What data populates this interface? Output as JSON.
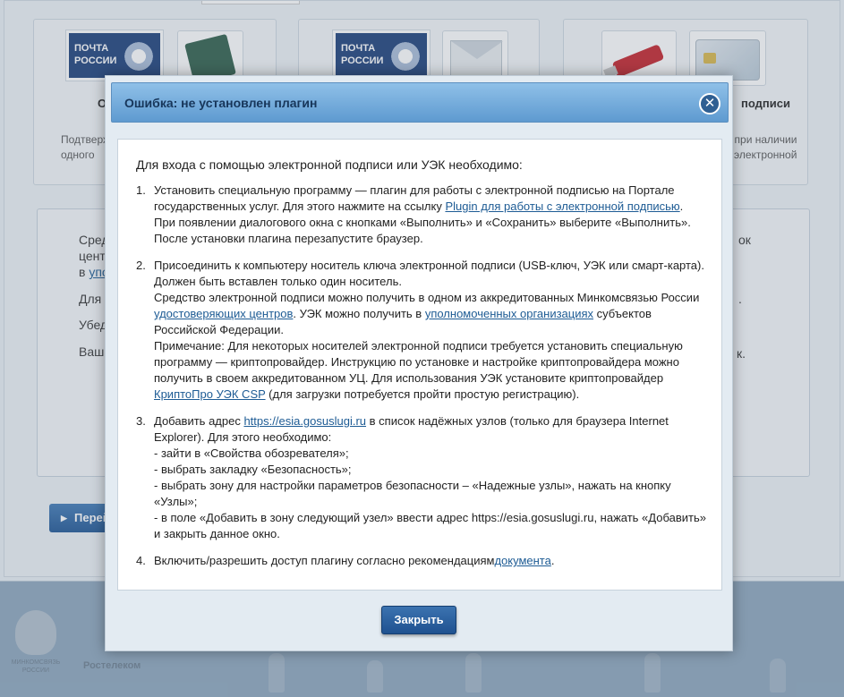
{
  "background": {
    "cards": [
      {
        "logo": "ПОЧТА РОССИИ",
        "logo_line1": "ПОЧТА",
        "logo_line2": "РОССИИ",
        "title_fragment": "О",
        "desc_fragment": "Подтверж\nодного"
      },
      {
        "logo": "ПОЧТА РОССИИ",
        "logo_line1": "ПОЧТА",
        "logo_line2": "РОССИИ",
        "title_fragment": "",
        "desc_fragment": ""
      },
      {
        "title_fragment": "подписи",
        "desc_fragment": "при наличии\nэлектронной"
      }
    ],
    "panel_left_texts": [
      "Сред",
      "цент",
      "в ",
      "упо",
      "Для",
      "Убед",
      "Ваш"
    ],
    "panel_right_texts": [
      "ок",
      ".",
      "к."
    ],
    "button_label": "Перей",
    "footer": {
      "minkom": "МИНКОМСВЯЗЬ РОССИИ",
      "rostelecom": "Ростелеком"
    }
  },
  "modal": {
    "title": "Ошибка: не установлен плагин",
    "intro": "Для входа с помощью электронной подписи или УЭК необходимо:",
    "steps": [
      {
        "num": "1.",
        "text_before_link": "Установить специальную программу — плагин для работы с электронной подписью на Портале государственных услуг. Для этого нажмите на ссылку ",
        "link": "Plugin для работы с электронной подписью",
        "text_after_link": ".",
        "line2": "При появлении диалогового окна с кнопками «Выполнить» и «Сохранить» выберите «Выполнить».",
        "line3": "После установки плагина перезапустите браузер."
      },
      {
        "num": "2.",
        "p1": "Присоединить к компьютеру носитель ключа электронной подписи (USB-ключ, УЭК или смарт-карта). Должен быть вставлен только один носитель.",
        "p2_a": "Средство электронной подписи можно получить в одном из аккредитованных Минкомсвязью России ",
        "p2_link1": "удостоверяющих центров",
        "p2_b": ". УЭК можно получить в ",
        "p2_link2": "уполномоченных организациях",
        "p2_c": " субъектов Российской Федерации.",
        "p3_a": "Примечание: Для некоторых носителей электронной подписи требуется установить специальную программу — криптопровайдер. Инструкцию по установке и настройке криптопровайдера можно получить в своем аккредитованном УЦ. Для использования УЭК установите криптопровайдер ",
        "p3_link": "КриптоПро УЭК CSP",
        "p3_b": " (для загрузки потребуется пройти простую регистрацию)."
      },
      {
        "num": "3.",
        "a": "Добавить адрес ",
        "link": "https://esia.gosuslugi.ru",
        "b": " в список надёжных узлов (только для браузера Internet Explorer). Для этого необходимо:",
        "items": [
          "- зайти в «Свойства обозревателя»;",
          "- выбрать закладку «Безопасность»;",
          "- выбрать зону для настройки параметров безопасности – «Надежные узлы», нажать на кнопку «Узлы»;",
          "- в поле «Добавить в зону следующий узел» ввести адрес https://esia.gosuslugi.ru, нажать «Добавить» и закрыть данное окно."
        ]
      },
      {
        "num": "4.",
        "a": "Включить/разрешить доступ плагину согласно рекомендациям",
        "link": "документа",
        "b": "."
      }
    ],
    "close_button": "Закрыть"
  }
}
